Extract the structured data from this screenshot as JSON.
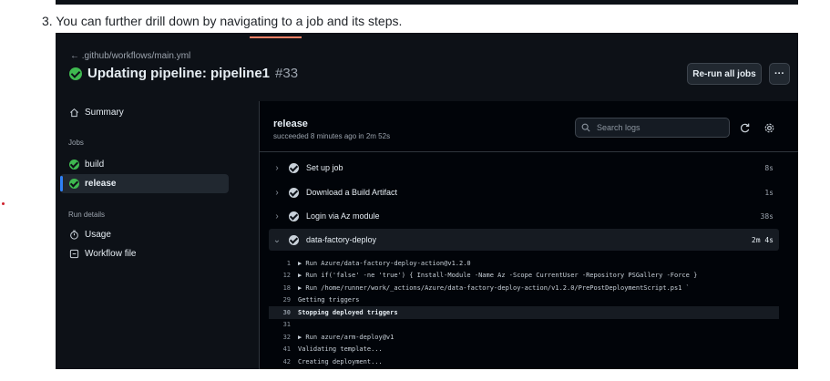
{
  "doc": {
    "caption": "3. You can further drill down by navigating to a job and its steps."
  },
  "header": {
    "back_link": "← .github/workflows/main.yml",
    "title": "Updating pipeline: pipeline1",
    "run_number": "#33",
    "rerun_label": "Re-run all jobs",
    "more_label": "···"
  },
  "sidebar": {
    "summary_label": "Summary",
    "jobs_heading": "Jobs",
    "jobs": [
      {
        "label": "build",
        "status": "success"
      },
      {
        "label": "release",
        "status": "success",
        "selected": true
      }
    ],
    "run_details_heading": "Run details",
    "usage_label": "Usage",
    "workflow_file_label": "Workflow file"
  },
  "job": {
    "title": "release",
    "subtitle": "succeeded 8 minutes ago in 2m 52s",
    "search_placeholder": "Search logs",
    "steps": [
      {
        "label": "Set up job",
        "duration": "8s",
        "expanded": false
      },
      {
        "label": "Download a Build Artifact",
        "duration": "1s",
        "expanded": false
      },
      {
        "label": "Login via Az module",
        "duration": "38s",
        "expanded": false
      },
      {
        "label": "data-factory-deploy",
        "duration": "2m 4s",
        "expanded": true
      }
    ],
    "log_lines": [
      {
        "num": "1",
        "text": "▶ Run Azure/data-factory-deploy-action@v1.2.0"
      },
      {
        "num": "12",
        "text": "▶ Run if('false' -ne 'true') { Install-Module -Name Az -Scope CurrentUser -Repository PSGallery -Force }"
      },
      {
        "num": "18",
        "text": "▶ Run /home/runner/work/_actions/Azure/data-factory-deploy-action/v1.2.0/PrePostDeploymentScript.ps1 `"
      },
      {
        "num": "29",
        "text": "Getting triggers"
      },
      {
        "num": "30",
        "text": "Stopping deployed triggers",
        "highlight": true
      },
      {
        "num": "31",
        "text": ""
      },
      {
        "num": "32",
        "text": "▶ Run azure/arm-deploy@v1"
      },
      {
        "num": "41",
        "text": "Validating template..."
      },
      {
        "num": "42",
        "text": "Creating deployment..."
      }
    ]
  },
  "colors": {
    "success": "#3fb950",
    "accent_blue": "#2f81f7",
    "background": "#0d1117"
  }
}
